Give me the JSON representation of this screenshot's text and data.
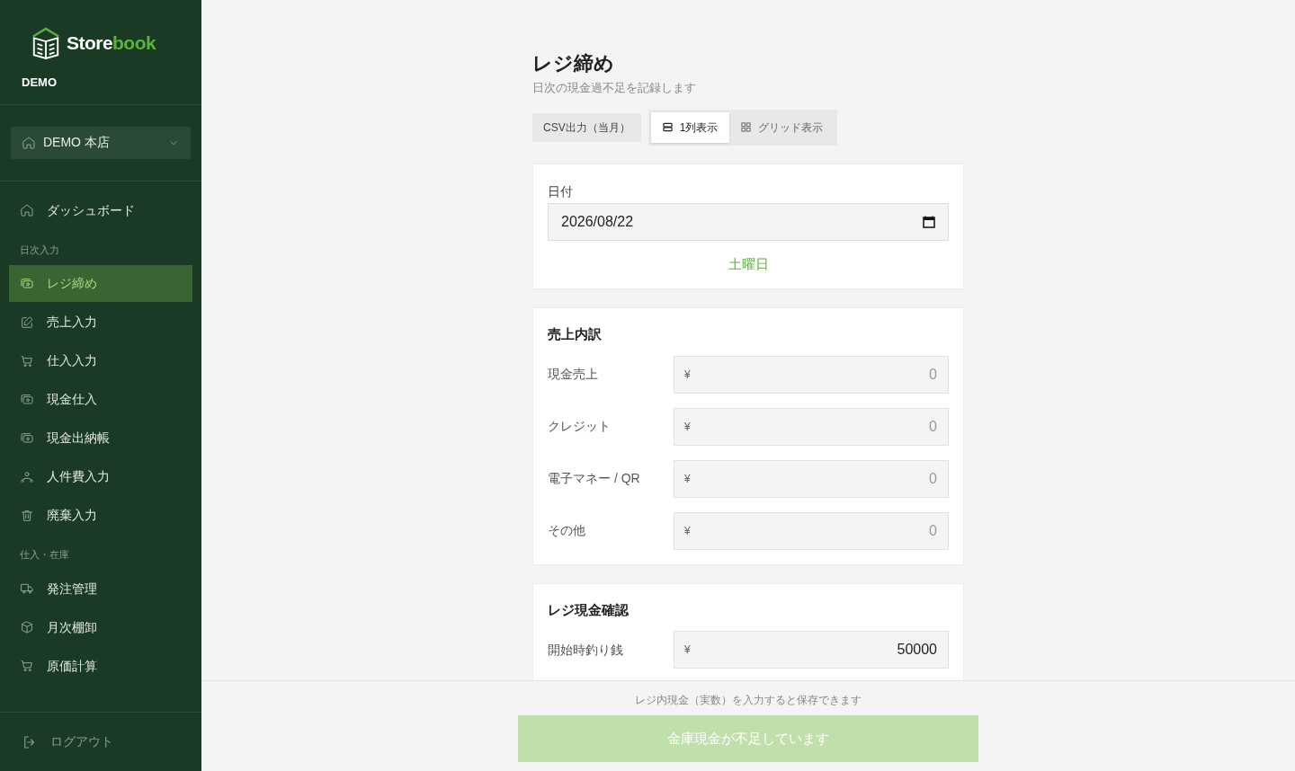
{
  "sidebar": {
    "logo": {
      "part_1": "Store",
      "part_2": "book"
    },
    "org": "DEMO",
    "store_select": {
      "value": "DEMO 本店"
    },
    "items": [
      {
        "kind": "item",
        "label": "ダッシュボード",
        "selected": false
      },
      {
        "kind": "section",
        "label": "日次入力"
      },
      {
        "kind": "item",
        "label": "レジ締め",
        "selected": true
      },
      {
        "kind": "item",
        "label": "売上入力",
        "selected": false
      },
      {
        "kind": "item",
        "label": "仕入入力",
        "selected": false
      },
      {
        "kind": "item",
        "label": "現金仕入",
        "selected": false
      },
      {
        "kind": "item",
        "label": "現金出納帳",
        "selected": false
      },
      {
        "kind": "item",
        "label": "人件費入力",
        "selected": false
      },
      {
        "kind": "item",
        "label": "廃棄入力",
        "selected": false
      },
      {
        "kind": "section",
        "label": "仕入・在庫"
      },
      {
        "kind": "item",
        "label": "発注管理",
        "selected": false
      },
      {
        "kind": "item",
        "label": "月次棚卸",
        "selected": false
      },
      {
        "kind": "item",
        "label": "原価計算",
        "selected": false
      }
    ],
    "logout": "ログアウト"
  },
  "page": {
    "title": "レジ締め",
    "subtitle": "日次の現金過不足を記録します",
    "csv_button": "CSV出力（当月）",
    "view_toggle": [
      {
        "label": "1列表示",
        "selected": true
      },
      {
        "label": "グリッド表示",
        "selected": false
      }
    ]
  },
  "date_card": {
    "label": "日付",
    "value": "2026/08/22",
    "weekday": "土曜日"
  },
  "cards": [
    {
      "title": "売上内訳",
      "fields": [
        {
          "label": "現金売上",
          "currency": "¥",
          "placeholder": "0"
        },
        {
          "label": "クレジット",
          "currency": "¥",
          "placeholder": "0"
        },
        {
          "label": "電子マネー / QR",
          "currency": "¥",
          "placeholder": "0"
        },
        {
          "label": "その他",
          "currency": "¥",
          "placeholder": "0"
        }
      ]
    },
    {
      "title": "レジ現金確認",
      "fields": [
        {
          "label": "開始時釣り銭",
          "currency": "¥",
          "value": "50000"
        }
      ]
    }
  ],
  "footer": {
    "hint": "レジ内現金（実数）を入力すると保存できます",
    "button": {
      "label": "金庫現金が不足しています",
      "disabled": true
    }
  }
}
